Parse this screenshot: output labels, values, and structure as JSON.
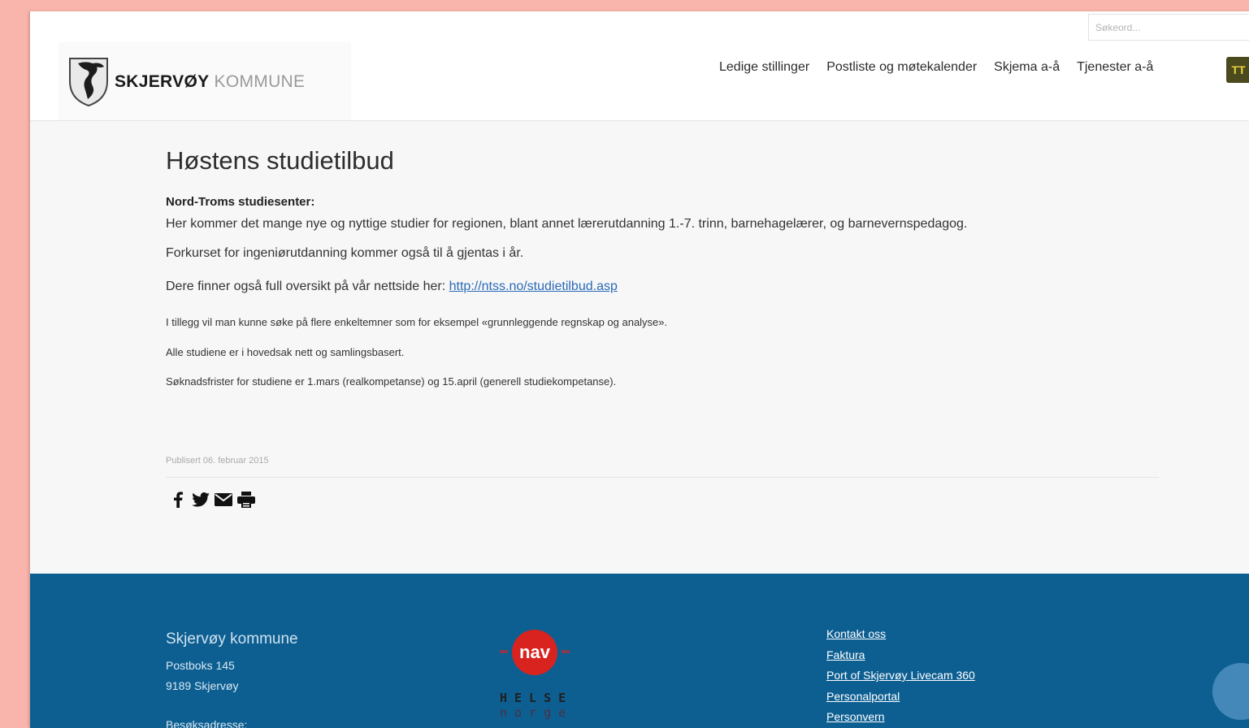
{
  "header": {
    "search_placeholder": "Søkeord...",
    "brand_bold": "SKJERVØY",
    "brand_light": "KOMMUNE",
    "nav": [
      {
        "label": "Ledige stillinger"
      },
      {
        "label": "Postliste og møtekalender"
      },
      {
        "label": "Skjema a-å"
      },
      {
        "label": "Tjenester a-å"
      }
    ],
    "nav_button_glyph": "ТT"
  },
  "article": {
    "title": "Høstens studietilbud",
    "subheading": "Nord-Troms studiesenter:",
    "para1": "Her kommer det mange nye og nyttige studier for regionen, blant annet lærerutdanning 1.-7. trinn, barnehagelærer, og barnevernspedagog.",
    "para2": "Forkurset for ingeniørutdanning kommer også til å gjentas i år.",
    "para3_prefix": "Dere finner også full oversikt på vår nettside her: ",
    "para3_link": "http://ntss.no/studietilbud.asp",
    "para4": "I tillegg vil man kunne søke på flere enkeltemner som for eksempel «grunnleggende regnskap og analyse».",
    "para5": "Alle studiene er i hovedsak nett og samlingsbasert.",
    "para6": "Søknadsfrister for studiene er 1.mars (realkompetanse) og 15.april (generell studiekompetanse).",
    "published": "Publisert 06. februar 2015",
    "share_icons": [
      "facebook-icon",
      "twitter-icon",
      "email-icon",
      "print-icon"
    ]
  },
  "footer": {
    "name": "Skjervøy kommune",
    "address1": "Postboks 145",
    "address2": "9189 Skjervøy",
    "address3": "Besøksadresse:",
    "nav_logo_text": "nav",
    "helse_line1": "HELSE",
    "helse_line2": "norge",
    "links": [
      {
        "label": "Kontakt oss"
      },
      {
        "label": "Faktura"
      },
      {
        "label": "Port of Skjervøy Livecam 360"
      },
      {
        "label": "Personalportal"
      },
      {
        "label": "Personvern"
      }
    ],
    "accent_color": "#0d5f92"
  }
}
